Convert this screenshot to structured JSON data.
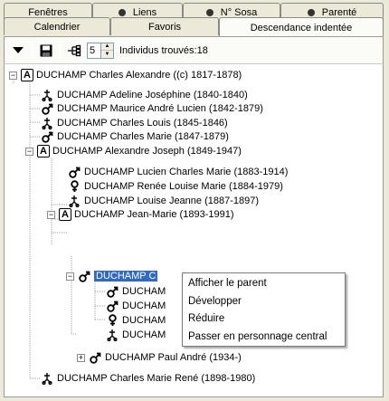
{
  "tabs_row1": [
    {
      "label": "Fenêtres",
      "dot": false
    },
    {
      "label": "Liens",
      "dot": true
    },
    {
      "label": "N° Sosa",
      "dot": true
    },
    {
      "label": "Parenté",
      "dot": true
    }
  ],
  "tabs_row2": [
    {
      "label": "Calendrier",
      "active": false
    },
    {
      "label": "Favoris",
      "active": false
    },
    {
      "label": "Descendance indentée",
      "active": true
    }
  ],
  "toolbar": {
    "depth_value": "5",
    "found_label": "Individus trouvés:18",
    "icons": [
      "dropdown-arrow-icon",
      "save-disk-icon",
      "tree-structure-icon"
    ]
  },
  "tree": [
    {
      "label": "DUCHAMP Charles Alexandre ((c) 1817-1878)",
      "icon": "ancestor-a-box",
      "expander": "minus"
    },
    {
      "label": "DUCHAMP Adeline Joséphine (1840-1840)",
      "icon": "death-cross-scissors"
    },
    {
      "label": "DUCHAMP Maurice André Lucien (1842-1879)",
      "icon": "male-symbol"
    },
    {
      "label": "DUCHAMP Charles Louis (1845-1846)",
      "icon": "death-cross-scissors"
    },
    {
      "label": "DUCHAMP Charles Marie (1847-1879)",
      "icon": "male-symbol"
    },
    {
      "label": "DUCHAMP Alexandre Joseph (1849-1947)",
      "icon": "ancestor-a-box",
      "expander": "minus"
    },
    {
      "label": "DUCHAMP Lucien Charles Marie (1883-1914)",
      "icon": "male-symbol"
    },
    {
      "label": "DUCHAMP Renée Louise Marie (1884-1979)",
      "icon": "female-symbol"
    },
    {
      "label": "DUCHAMP Louise Jeanne (1887-1897)",
      "icon": "death-cross-scissors"
    },
    {
      "label": "DUCHAMP Jean-Marie (1893-1991)",
      "icon": "ancestor-a-box",
      "expander": "minus"
    },
    {
      "label": "DUCHAMP C",
      "icon": "male-symbol",
      "expander": "minus",
      "selected": true
    },
    {
      "label": "DUCHAM",
      "icon": "male-symbol"
    },
    {
      "label": "DUCHAM",
      "icon": "male-symbol"
    },
    {
      "label": "DUCHAM",
      "icon": "female-symbol"
    },
    {
      "label": "DUCHAM",
      "icon": "death-cross-scissors"
    },
    {
      "label": "DUCHAMP Paul André (1934-)",
      "icon": "male-symbol",
      "expander": "plus"
    },
    {
      "label": "DUCHAMP Charles Marie René (1898-1980)",
      "icon": "death-cross-scissors"
    }
  ],
  "context_menu": [
    "Afficher le parent",
    "Développer",
    "Réduire",
    "Passer en personnage central"
  ]
}
